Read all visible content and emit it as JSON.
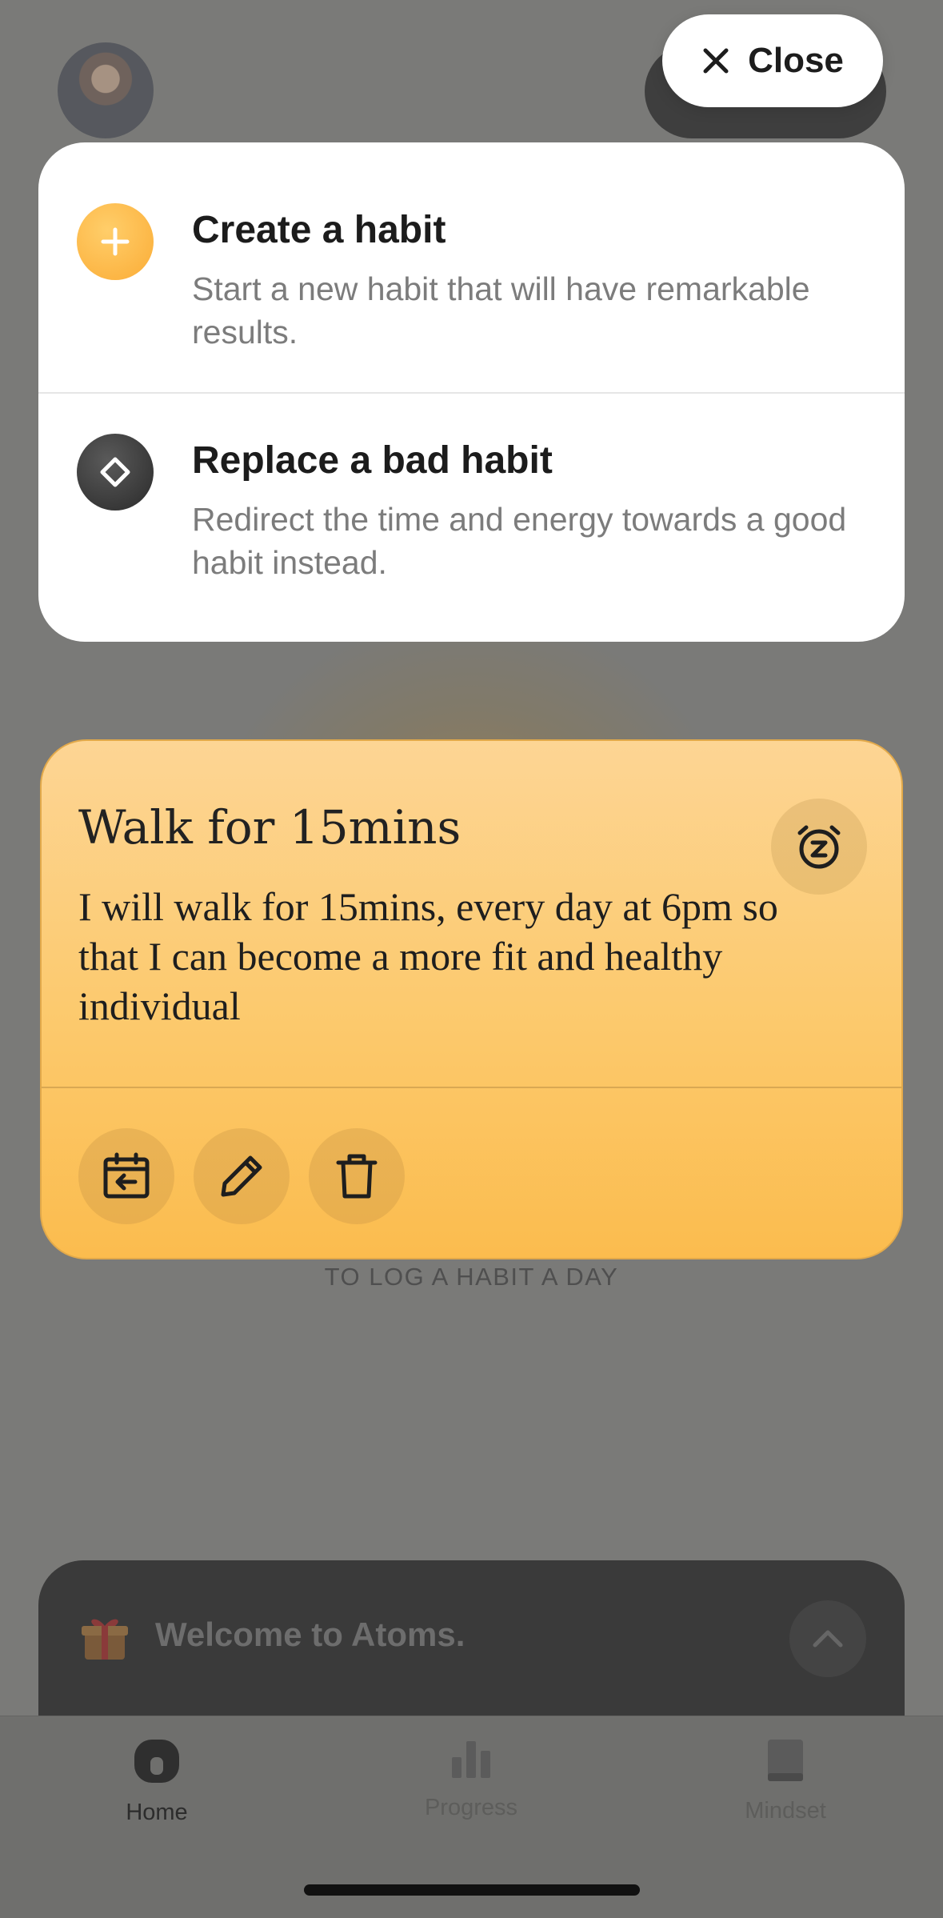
{
  "close_button": {
    "label": "Close",
    "icon": "close-icon"
  },
  "menu": {
    "items": [
      {
        "title": "Create a habit",
        "description": "Start a new habit that will have remarkable results.",
        "icon": "plus-icon",
        "icon_color": "#fbb03b"
      },
      {
        "title": "Replace a bad habit",
        "description": "Redirect the time and energy towards a good habit instead.",
        "icon": "diamond-icon",
        "icon_color": "#3c3c3c"
      }
    ]
  },
  "habit": {
    "title": "Walk for 15mins",
    "description": "I will walk for 15mins, every day at 6pm so that I can become a more fit and healthy individual",
    "actions": [
      "snooze-icon",
      "calendar-back-icon",
      "pencil-icon",
      "trash-icon"
    ]
  },
  "background": {
    "log_hint": "TO LOG A HABIT A DAY",
    "welcome_text": "Welcome to Atoms."
  },
  "tabs": [
    {
      "label": "Home",
      "icon": "home-icon",
      "active": true
    },
    {
      "label": "Progress",
      "icon": "bar-chart-icon",
      "active": false
    },
    {
      "label": "Mindset",
      "icon": "book-icon",
      "active": false
    }
  ],
  "colors": {
    "accent": "#fbb03b",
    "card_gradient_top": "#fdd594",
    "card_gradient_bottom": "#fbbc4e"
  }
}
